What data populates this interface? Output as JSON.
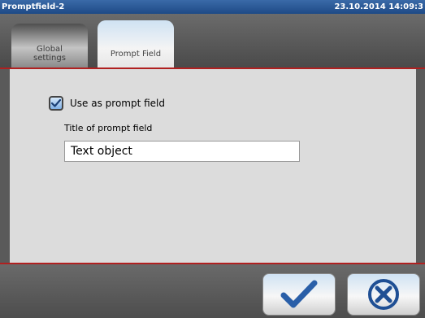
{
  "window": {
    "title": "Promptfield-2",
    "datetime": "23.10.2014 14:09:3"
  },
  "tabs": [
    {
      "label": "Global\nsettings",
      "active": false
    },
    {
      "label": "Prompt Field",
      "active": true
    }
  ],
  "form": {
    "checkbox_label": "Use as prompt field",
    "checkbox_checked": true,
    "title_label": "Title of prompt field",
    "title_value": "Text object"
  },
  "footer": {
    "ok_icon": "checkmark-icon",
    "cancel_icon": "cancel-x-icon"
  },
  "colors": {
    "accent_red": "#b02020",
    "ok_blue": "#2a5fa8"
  }
}
